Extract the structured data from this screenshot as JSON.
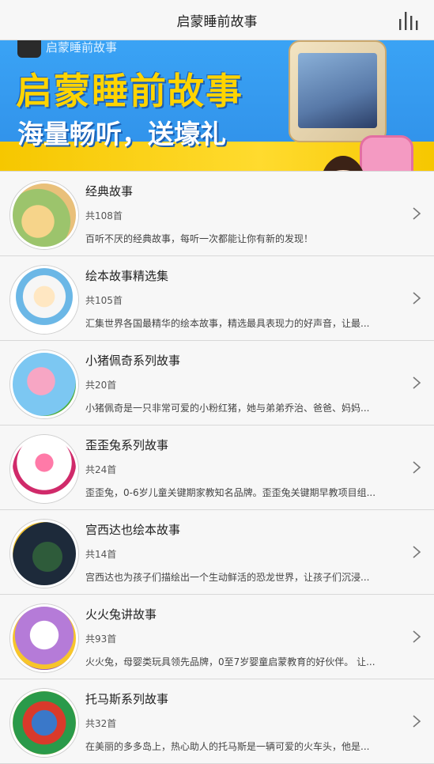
{
  "header": {
    "title": "启蒙睡前故事",
    "menu_icon": "bars-icon"
  },
  "banner": {
    "small_title": "启蒙睡前故事",
    "headline": "启蒙睡前故事",
    "slogan": "海量畅听，送壕礼",
    "colors": {
      "sky": "#3aa3f5",
      "headline": "#ffd400",
      "band": "#f6c700"
    }
  },
  "stories": [
    {
      "title": "经典故事",
      "count": "共108首",
      "desc": "百听不厌的经典故事，每听一次都能让你有新的发现！",
      "thumb": "classic-story-thumb"
    },
    {
      "title": "绘本故事精选集",
      "count": "共105首",
      "desc": "汇集世界各国最精华的绘本故事，精选最具表现力的好声音，让最...",
      "thumb": "picture-book-thumb"
    },
    {
      "title": "小猪佩奇系列故事",
      "count": "共20首",
      "desc": "小猪佩奇是一只非常可爱的小粉红猪，她与弟弟乔治、爸爸、妈妈...",
      "thumb": "peppa-pig-thumb"
    },
    {
      "title": "歪歪兔系列故事",
      "count": "共24首",
      "desc": "歪歪兔，0-6岁儿童关键期家教知名品牌。歪歪兔关键期早教项目组...",
      "thumb": "waiwaitu-thumb"
    },
    {
      "title": "宫西达也绘本故事",
      "count": "共14首",
      "desc": "宫西达也为孩子们描绘出一个生动鲜活的恐龙世界，让孩子们沉浸...",
      "thumb": "miyanishi-thumb"
    },
    {
      "title": "火火兔讲故事",
      "count": "共93首",
      "desc": "火火兔，母婴类玩具领先品牌，0至7岁婴童启蒙教育的好伙伴。 让...",
      "thumb": "huohuotu-thumb"
    },
    {
      "title": "托马斯系列故事",
      "count": "共32首",
      "desc": "在美丽的多多岛上，热心助人的托马斯是一辆可爱的火车头，他是...",
      "thumb": "thomas-thumb"
    }
  ]
}
